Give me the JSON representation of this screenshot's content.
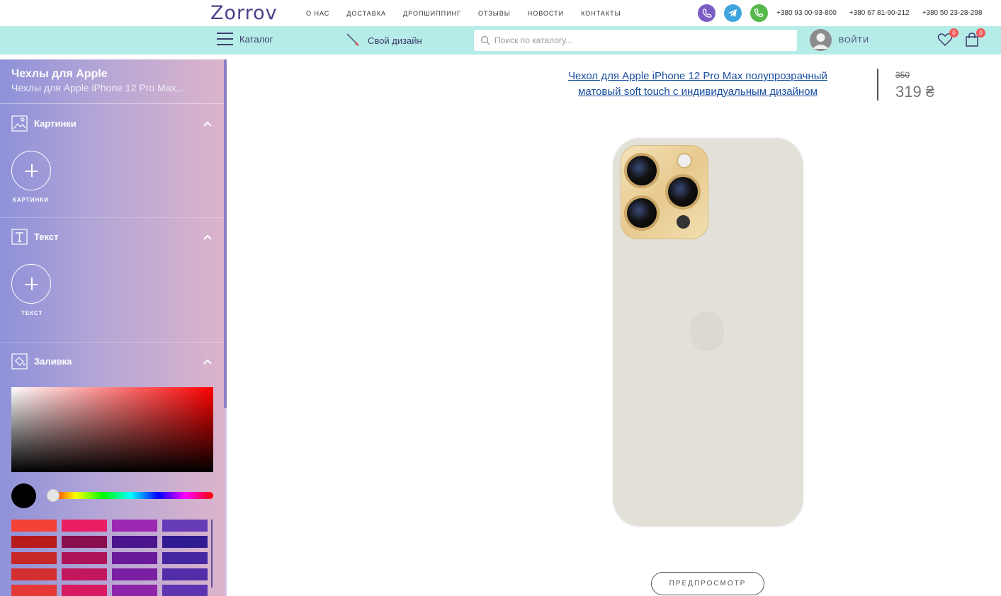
{
  "header": {
    "logo": "Zorrov",
    "nav": [
      "О НАС",
      "ДОСТАВКА",
      "ДРОПШИППИНГ",
      "ОТЗЫВЫ",
      "НОВОСТИ",
      "КОНТАКТЫ"
    ],
    "phones": [
      "+380 93 00-93-800",
      "+380 67 81-90-212",
      "+380 50 23-28-298"
    ],
    "messengers": [
      "viber-icon",
      "telegram-icon",
      "phone-icon"
    ]
  },
  "subbar": {
    "catalog_label": "Каталог",
    "design_label": "Свой дизайн",
    "search_placeholder": "Поиск по каталогу...",
    "login_label": "ВОЙТИ",
    "wishlist_count": "0",
    "cart_count": "0"
  },
  "sidebar": {
    "title": "Чехлы для Apple",
    "subtitle": "Чехлы для Apple iPhone 12 Pro Max,...",
    "sections": {
      "images": {
        "title": "Картинки",
        "button_label": "КАРТИНКИ"
      },
      "text": {
        "title": "Текст",
        "button_label": "ТЕКСТ"
      },
      "fill": {
        "title": "Заливка"
      }
    },
    "selected_color": "#000000",
    "palette": [
      "#f44336",
      "#e91e63",
      "#9c27b0",
      "#673ab7",
      "#b71c1c",
      "#880e4f",
      "#4a148c",
      "#311b92",
      "#c62828",
      "#ad1457",
      "#6a1b9a",
      "#4527a0",
      "#d32f2f",
      "#c2185b",
      "#7b1fa2",
      "#512da8",
      "#e53935",
      "#d81b60",
      "#8e24aa",
      "#5e35b1"
    ]
  },
  "product": {
    "title": "Чехол для Apple iPhone 12 Pro Max полупрозрачный матовый soft touch с индивидуальным дизайном",
    "old_price": "350",
    "price": "319 ₴",
    "preview_label": "ПРЕДПРОСМОТР"
  }
}
